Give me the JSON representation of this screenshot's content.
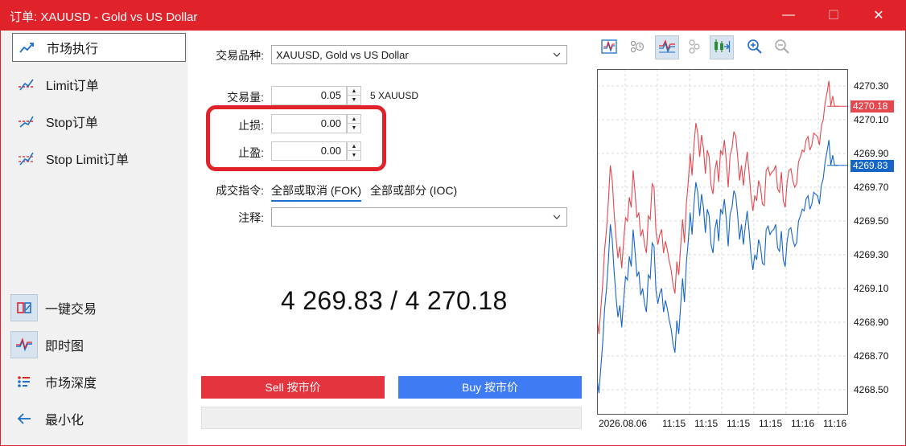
{
  "window": {
    "title": "订单: XAUUSD - Gold vs US Dollar",
    "minimize_glyph": "—",
    "maximize_glyph": "☐",
    "close_glyph": "✕"
  },
  "sidebar": {
    "order_types": [
      {
        "label": "市场执行",
        "icon": "market-execution-icon",
        "active": true
      },
      {
        "label": "Limit订单",
        "icon": "limit-order-icon",
        "active": false
      },
      {
        "label": "Stop订单",
        "icon": "stop-order-icon",
        "active": false
      },
      {
        "label": "Stop Limit订单",
        "icon": "stop-limit-order-icon",
        "active": false
      }
    ],
    "tools": [
      {
        "label": "一键交易",
        "icon": "one-click-trading-icon",
        "pressed": true
      },
      {
        "label": "即时图",
        "icon": "tick-chart-icon",
        "pressed": true
      },
      {
        "label": "市场深度",
        "icon": "market-depth-icon",
        "pressed": false
      },
      {
        "label": "最小化",
        "icon": "arrow-left-icon",
        "pressed": false
      }
    ]
  },
  "form": {
    "symbol_label": "交易品种:",
    "symbol_value": "XAUUSD, Gold vs US Dollar",
    "volume_label": "交易量:",
    "volume_value": "0.05",
    "volume_hint": "5 XAUUSD",
    "sl_label": "止损:",
    "sl_value": "0.00",
    "tp_label": "止盈:",
    "tp_value": "0.00",
    "fill_label": "成交指令:",
    "fill_options": [
      "全部或取消 (FOK)",
      "全部或部分 (IOC)"
    ],
    "comment_label": "注释:",
    "comment_value": ""
  },
  "quote": {
    "bid": "4 269.83",
    "separator": "/",
    "ask": "4 270.18"
  },
  "buttons": {
    "sell": "Sell 按市价",
    "buy": "Buy 按市价"
  },
  "colors": {
    "title_bar": "#e0232b",
    "sell": "#e4343e",
    "buy": "#3f7cf4",
    "ask_line": "#e4474e",
    "bid_line": "#1565c8",
    "grid": "#d8d8d8"
  },
  "chart_toolbar": [
    {
      "icon": "tick-chart-icon",
      "pressed": false
    },
    {
      "icon": "time-settings-icon",
      "pressed": false
    },
    {
      "icon": "bid-ask-lines-icon",
      "pressed": true
    },
    {
      "icon": "trades-dots-icon",
      "pressed": false
    },
    {
      "icon": "auto-scroll-icon",
      "pressed": true
    },
    {
      "icon": "zoom-in-icon",
      "pressed": false
    },
    {
      "icon": "zoom-out-icon",
      "pressed": false
    }
  ],
  "chart_data": {
    "type": "line",
    "title": "",
    "xlabel": "",
    "ylabel": "",
    "ylim": [
      4268.4,
      4270.4
    ],
    "y_ticks": [
      "4270.30",
      "4270.10",
      "4269.90",
      "4269.70",
      "4269.50",
      "4269.30",
      "4269.10",
      "4268.90",
      "4268.70",
      "4268.50"
    ],
    "x_ticks": [
      "2026.08.06",
      "11:15",
      "11:15",
      "11:15",
      "11:15",
      "11:15",
      "11:16",
      "11:16"
    ],
    "grid": true,
    "last_ask": "4270.18",
    "last_bid": "4269.83",
    "series": [
      {
        "role": "ask",
        "values": [
          4268.92,
          4268.83,
          4268.98,
          4269.13,
          4269.33,
          4269.45,
          4269.62,
          4269.83,
          4269.74,
          4269.55,
          4269.4,
          4269.28,
          4269.35,
          4269.22,
          4269.38,
          4269.52,
          4269.5,
          4269.64,
          4269.58,
          4269.8,
          4269.67,
          4269.52,
          4269.55,
          4269.41,
          4269.45,
          4269.36,
          4269.31,
          4269.53,
          4269.51,
          4269.72,
          4269.7,
          4269.44,
          4269.36,
          4269.42,
          4269.45,
          4269.31,
          4269.38,
          4269.33,
          4269.26,
          4269.21,
          4269.12,
          4269.07,
          4269.26,
          4269.18,
          4269.35,
          4269.51,
          4269.37,
          4269.6,
          4269.73,
          4269.9,
          4269.77,
          4269.95,
          4270.08,
          4270.02,
          4269.88,
          4270.01,
          4269.93,
          4269.78,
          4269.92,
          4269.88,
          4269.71,
          4269.66,
          4269.8,
          4269.86,
          4269.73,
          4269.92,
          4269.89,
          4269.98,
          4269.86,
          4269.7,
          4269.89,
          4269.93,
          4270.03,
          4270.0,
          4269.88,
          4269.74,
          4269.83,
          4269.71,
          4269.82,
          4269.91,
          4269.79,
          4269.65,
          4269.56,
          4269.65,
          4269.62,
          4269.74,
          4269.7,
          4269.6,
          4269.59,
          4269.8,
          4269.82,
          4269.77,
          4269.79,
          4269.8,
          4269.83,
          4269.69,
          4269.67,
          4269.79,
          4269.62,
          4269.58,
          4269.73,
          4269.8,
          4269.81,
          4269.74,
          4269.7,
          4269.72,
          4269.85,
          4269.88,
          4269.92,
          4269.91,
          4269.98,
          4270.0,
          4269.92,
          4269.95,
          4270.02,
          4270.01,
          4270.0,
          4269.95,
          4270.06,
          4270.1,
          4270.2,
          4270.26,
          4270.33,
          4270.18,
          4270.24,
          4270.18,
          4270.18,
          4270.18
        ]
      },
      {
        "role": "bid",
        "values": [
          4268.57,
          4268.48,
          4268.63,
          4268.78,
          4268.98,
          4269.1,
          4269.27,
          4269.48,
          4269.39,
          4269.2,
          4269.05,
          4268.93,
          4269.0,
          4268.87,
          4269.03,
          4269.17,
          4269.15,
          4269.29,
          4269.23,
          4269.45,
          4269.32,
          4269.17,
          4269.2,
          4269.06,
          4269.1,
          4269.01,
          4268.96,
          4269.18,
          4269.16,
          4269.37,
          4269.35,
          4269.09,
          4269.01,
          4269.07,
          4269.1,
          4268.96,
          4269.03,
          4268.98,
          4268.91,
          4268.86,
          4268.77,
          4268.72,
          4268.91,
          4268.83,
          4269.0,
          4269.16,
          4269.02,
          4269.25,
          4269.38,
          4269.55,
          4269.42,
          4269.6,
          4269.73,
          4269.67,
          4269.53,
          4269.66,
          4269.58,
          4269.43,
          4269.57,
          4269.53,
          4269.36,
          4269.31,
          4269.45,
          4269.51,
          4269.38,
          4269.57,
          4269.54,
          4269.63,
          4269.51,
          4269.35,
          4269.54,
          4269.58,
          4269.68,
          4269.65,
          4269.53,
          4269.39,
          4269.48,
          4269.36,
          4269.47,
          4269.56,
          4269.44,
          4269.3,
          4269.21,
          4269.3,
          4269.27,
          4269.39,
          4269.35,
          4269.25,
          4269.24,
          4269.45,
          4269.47,
          4269.42,
          4269.44,
          4269.45,
          4269.48,
          4269.34,
          4269.32,
          4269.44,
          4269.27,
          4269.23,
          4269.38,
          4269.45,
          4269.46,
          4269.39,
          4269.35,
          4269.37,
          4269.5,
          4269.53,
          4269.57,
          4269.56,
          4269.63,
          4269.65,
          4269.57,
          4269.6,
          4269.67,
          4269.66,
          4269.65,
          4269.6,
          4269.71,
          4269.75,
          4269.85,
          4269.91,
          4269.98,
          4269.83,
          4269.89,
          4269.83,
          4269.83,
          4269.83
        ]
      }
    ]
  }
}
